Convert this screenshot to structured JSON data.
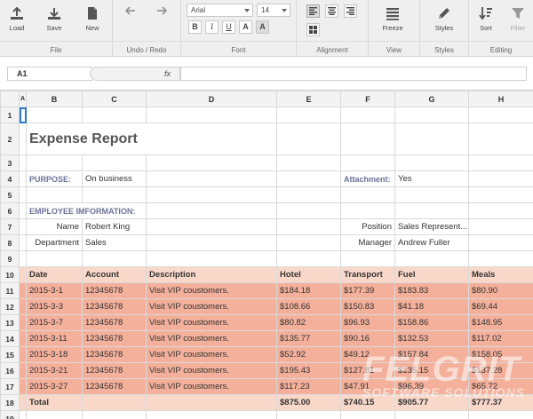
{
  "ribbon": {
    "file": {
      "label": "File",
      "load": "Load",
      "save": "Save",
      "new": "New"
    },
    "undo_redo": {
      "label": "Undo / Redo"
    },
    "font": {
      "label": "Font",
      "family": "Arial",
      "size": "14",
      "bold": "B",
      "italic": "I",
      "underline": "U",
      "font_color": "A",
      "fill_color": "A"
    },
    "alignment": {
      "label": "Alignment"
    },
    "view": {
      "label": "View",
      "freeze": "Freeze"
    },
    "styles": {
      "label": "Styles",
      "styles": "Styles"
    },
    "editing": {
      "label": "Editing",
      "sort": "Sort",
      "filter": "Filter"
    }
  },
  "formula_bar": {
    "cell_ref": "A1",
    "fx": "fx",
    "value": ""
  },
  "grid": {
    "columns": [
      "A",
      "B",
      "C",
      "D",
      "E",
      "F",
      "G",
      "H"
    ],
    "rows": [
      "1",
      "2",
      "3",
      "4",
      "5",
      "6",
      "7",
      "8",
      "9",
      "10",
      "11",
      "12",
      "13",
      "14",
      "15",
      "16",
      "17",
      "18",
      "19"
    ],
    "title": "Expense Report",
    "purpose_label": "PURPOSE:",
    "purpose_value": "On business",
    "attachment_label": "Attachment:",
    "attachment_value": "Yes",
    "employee_info": "EMPLOYEE IMFORMATION:",
    "name_label": "Name",
    "name_value": "Robert King",
    "position_label": "Position",
    "position_value": "Sales Represent...",
    "department_label": "Department",
    "department_value": "Sales",
    "manager_label": "Manager",
    "manager_value": "Andrew Fuller",
    "table_headers": [
      "Date",
      "Account",
      "Description",
      "Hotel",
      "Transport",
      "Fuel",
      "Meals"
    ],
    "table_rows": [
      [
        "2015-3-1",
        "12345678",
        "Visit VIP coustomers.",
        "$184.18",
        "$177.39",
        "$183.83",
        "$80.90"
      ],
      [
        "2015-3-3",
        "12345678",
        "Visit VIP coustomers.",
        "$108.66",
        "$150.83",
        "$41.18",
        "$69.44"
      ],
      [
        "2015-3-7",
        "12345678",
        "Visit VIP coustomers.",
        "$80.82",
        "$96.93",
        "$158.86",
        "$148.95"
      ],
      [
        "2015-3-11",
        "12345678",
        "Visit VIP coustomers.",
        "$135.77",
        "$90.16",
        "$132.53",
        "$117.02"
      ],
      [
        "2015-3-18",
        "12345678",
        "Visit VIP coustomers.",
        "$52.92",
        "$49.12",
        "$157.84",
        "$158.05"
      ],
      [
        "2015-3-21",
        "12345678",
        "Visit VIP coustomers.",
        "$195.43",
        "$127.81",
        "$135.15",
        "$137.28"
      ],
      [
        "2015-3-27",
        "12345678",
        "Visit VIP coustomers.",
        "$117.23",
        "$47.91",
        "$96.39",
        "$65.72"
      ]
    ],
    "total_label": "Total",
    "totals": [
      "$875.00",
      "$740.15",
      "$905.77",
      "$777.37"
    ]
  },
  "watermark": {
    "main": "FELGRIT",
    "sub": "SOFTWARE SOLUTIONS"
  }
}
